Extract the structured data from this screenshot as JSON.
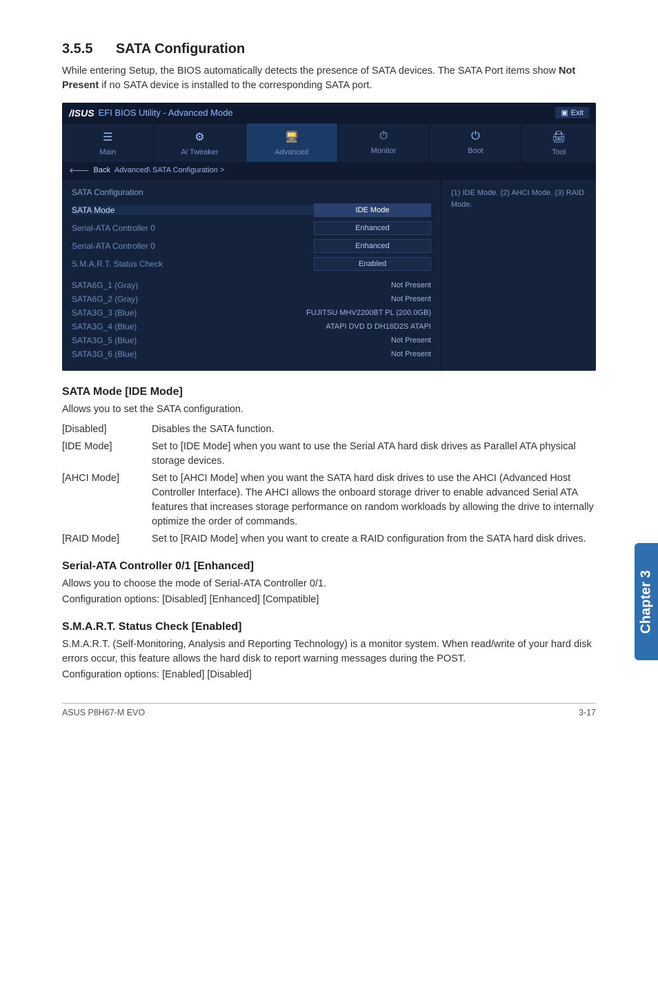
{
  "section": {
    "number": "3.5.5",
    "title": "SATA Configuration",
    "intro": "While entering Setup, the BIOS automatically detects the presence of SATA devices. The SATA Port items show Not Present if no SATA device is installed to the corresponding SATA port.",
    "intro_bold": "Not Present"
  },
  "bios": {
    "logo": "/ISUS",
    "title": "EFI BIOS Utility - Advanced Mode",
    "exit": "Exit",
    "tabs": [
      {
        "label": "Main",
        "icon": "☰"
      },
      {
        "label": "Ai  Tweaker",
        "icon": "⚙"
      },
      {
        "label": "Advanced",
        "icon": "🖥"
      },
      {
        "label": "Monitor",
        "icon": "⏱"
      },
      {
        "label": "Boot",
        "icon": "⏻"
      },
      {
        "label": "Tool",
        "icon": "🖨"
      }
    ],
    "breadcrumb": {
      "back": "Back",
      "path": "Advanced\\ SATA Configuration  >"
    },
    "help": "(1) IDE Mode. (2) AHCI Mode. (3) RAID Mode.",
    "cfg_header": "SATA Configuration",
    "rows": [
      {
        "label": "SATA Mode",
        "value": "IDE Mode",
        "type": "box",
        "highlight": true,
        "sel": true
      },
      {
        "label": "Serial-ATA Controller 0",
        "value": "Enhanced",
        "type": "box"
      },
      {
        "label": "Serial-ATA Controller 0",
        "value": "Enhanced",
        "type": "box"
      },
      {
        "label": "S.M.A.R.T. Status Check",
        "value": "Enabled",
        "type": "box"
      },
      {
        "label": "",
        "value": "",
        "type": "spacer"
      },
      {
        "label": "SATA6G_1 (Gray)",
        "value": "Not Present",
        "type": "plain"
      },
      {
        "label": "SATA6G_2 (Gray)",
        "value": "Not Present",
        "type": "plain"
      },
      {
        "label": "SATA3G_3 (Blue)",
        "value": "FUJITSU MHV2200BT PL (200.0GB)",
        "type": "plain"
      },
      {
        "label": "SATA3G_4 (Blue)",
        "value": "ATAPI DVD D DH16D2S ATAPI",
        "type": "plain"
      },
      {
        "label": "SATA3G_5 (Blue)",
        "value": "Not Present",
        "type": "plain"
      },
      {
        "label": "SATA3G_6 (Blue)",
        "value": "Not Present",
        "type": "plain"
      }
    ]
  },
  "sub1": {
    "heading": "SATA Mode [IDE Mode]",
    "lead": "Allows you to set the SATA configuration.",
    "options": [
      {
        "key": "[Disabled]",
        "val": "Disables the SATA function."
      },
      {
        "key": "[IDE Mode]",
        "val": "Set to [IDE Mode] when you want to use the Serial ATA hard disk drives as Parallel ATA physical storage devices."
      },
      {
        "key": "[AHCI Mode]",
        "val": "Set to [AHCI Mode] when you want the SATA hard disk drives to use the AHCI (Advanced Host Controller Interface). The AHCI allows the onboard storage driver to enable advanced Serial ATA features that increases storage performance on random workloads by allowing the drive to internally optimize the order of commands."
      },
      {
        "key": "[RAID Mode]",
        "val": "Set to [RAID Mode] when you want to create a RAID configuration from the SATA hard disk drives."
      }
    ]
  },
  "sub2": {
    "heading": "Serial-ATA Controller 0/1 [Enhanced]",
    "line1": "Allows you to choose the mode of Serial-ATA Controller 0/1.",
    "line2": "Configuration options: [Disabled] [Enhanced] [Compatible]"
  },
  "sub3": {
    "heading": "S.M.A.R.T. Status Check [Enabled]",
    "line1": "S.M.A.R.T. (Self-Monitoring, Analysis and Reporting Technology) is a monitor system. When read/write of your hard disk errors occur, this feature allows the hard disk to report warning messages during the POST.",
    "line2": "Configuration options: [Enabled] [Disabled]"
  },
  "sidetab": "Chapter 3",
  "footer": {
    "left": "ASUS P8H67-M EVO",
    "right": "3-17"
  }
}
